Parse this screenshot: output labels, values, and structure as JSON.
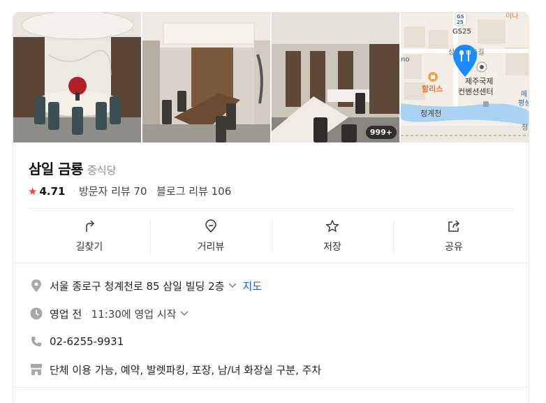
{
  "photos": {
    "count_badge": "999+"
  },
  "map": {
    "labels": [
      "GS25",
      "5길",
      "할리스",
      "제주국제",
      "컨벤션센터",
      "청계천",
      "메",
      "평성",
      "이나",
      "no",
      "GS",
      "25",
      "상",
      "청"
    ],
    "marker": "restaurant-pin-icon"
  },
  "place": {
    "name": "삼일 금룡",
    "category": "중식당",
    "rating": "4.71",
    "visitor_reviews": "방문자 리뷰 70",
    "blog_reviews": "블로그 리뷰 106"
  },
  "actions": [
    {
      "label": "길찾기",
      "icon": "directions-icon"
    },
    {
      "label": "거리뷰",
      "icon": "streetview-pin-icon"
    },
    {
      "label": "저장",
      "icon": "star-outline-icon"
    },
    {
      "label": "공유",
      "icon": "share-icon"
    }
  ],
  "info": {
    "address": "서울 종로구 청계천로 85 삼일 빌딩 2층",
    "map_link": "지도",
    "hours_status": "영업 전",
    "hours_detail": "11:30에 영업 시작",
    "phone": "02-6255-9931",
    "amenities": "단체 이용 가능, 예약, 발렛파킹, 포장, 남/녀 화장실 구분, 주차"
  },
  "colors": {
    "star": "#ff3c3c",
    "link": "#1a5bd7",
    "map_pin": "#1a8cff",
    "map_water": "#a8d3f2"
  }
}
